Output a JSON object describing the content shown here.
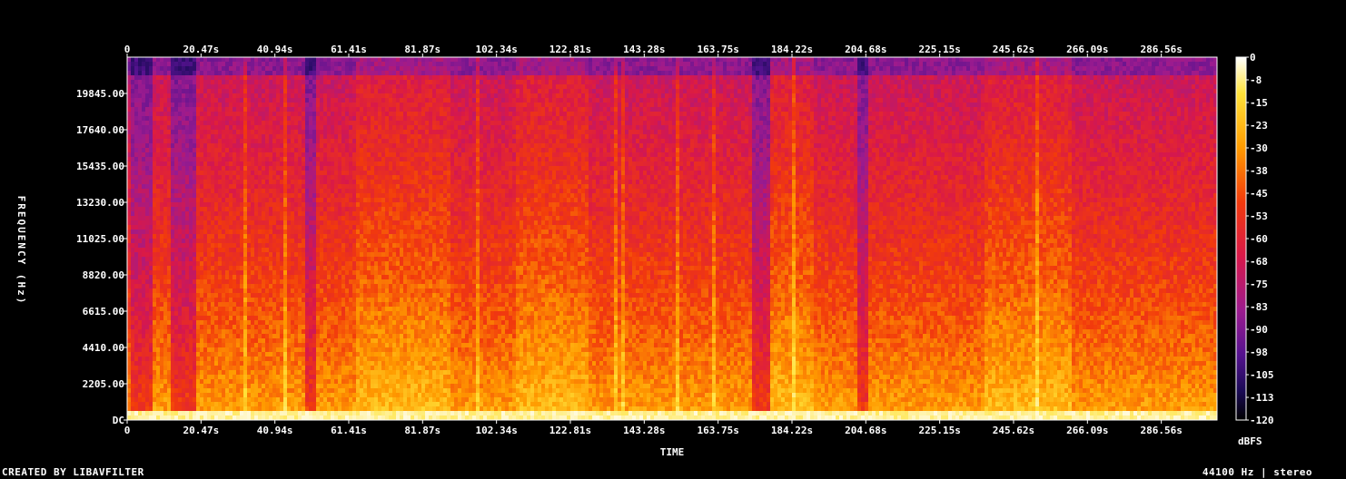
{
  "chart_data": {
    "type": "heatmap",
    "title": "",
    "xlabel": "TIME",
    "ylabel": "FREQUENCY (Hz)",
    "x_ticks": [
      "0",
      "20.47s",
      "40.94s",
      "61.41s",
      "81.87s",
      "102.34s",
      "122.81s",
      "143.28s",
      "163.75s",
      "184.22s",
      "204.68s",
      "225.15s",
      "245.62s",
      "266.09s",
      "286.56s"
    ],
    "x_tick_values": [
      0,
      20.47,
      40.94,
      61.41,
      81.87,
      102.34,
      122.81,
      143.28,
      163.75,
      184.22,
      204.68,
      225.15,
      245.62,
      266.09,
      286.56
    ],
    "xlim": [
      0,
      302
    ],
    "y_ticks": [
      "DC",
      "2205.00",
      "4410.00",
      "6615.00",
      "8820.00",
      "11025.00",
      "13230.00",
      "15435.00",
      "17640.00",
      "19845.00"
    ],
    "y_tick_values": [
      0,
      2205,
      4410,
      6615,
      8820,
      11025,
      13230,
      15435,
      17640,
      19845
    ],
    "ylim": [
      0,
      22050
    ],
    "colorbar": {
      "label": "dBFS",
      "ticks": [
        "0",
        "-8",
        "-15",
        "-23",
        "-30",
        "-38",
        "-45",
        "-53",
        "-60",
        "-68",
        "-75",
        "-83",
        "-90",
        "-98",
        "-105",
        "-113",
        "-120"
      ],
      "range": [
        -120,
        0
      ],
      "colors": [
        "#000000",
        "#1a0a55",
        "#55128f",
        "#9b1b8f",
        "#d8184a",
        "#f23a0c",
        "#ff9b00",
        "#ffe33a",
        "#ffffff"
      ]
    },
    "quiet_regions_seconds": [
      [
        0,
        7
      ],
      [
        12,
        19
      ],
      [
        49,
        52
      ],
      [
        173,
        178
      ],
      [
        202,
        205
      ]
    ],
    "loud_regions_seconds": [
      [
        63,
        90
      ],
      [
        108,
        128
      ],
      [
        178,
        190
      ],
      [
        238,
        262
      ]
    ]
  },
  "footer": {
    "left": "CREATED BY LIBAVFILTER",
    "right": "44100 Hz | stereo"
  }
}
